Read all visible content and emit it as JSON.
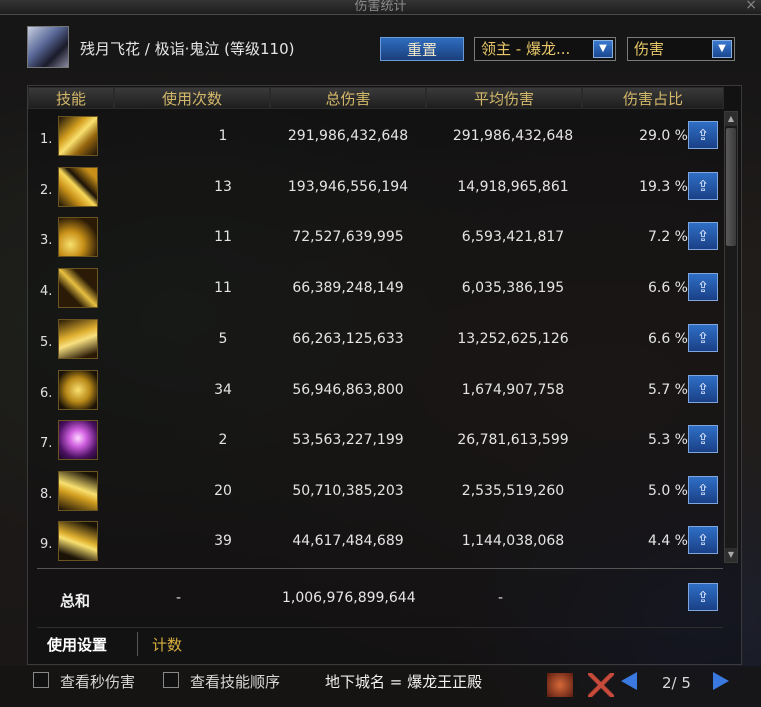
{
  "window": {
    "title": "伤害统计"
  },
  "character": {
    "name": "残月飞花 / 极诣·鬼泣 (等级110)"
  },
  "controls": {
    "reset_label": "重置",
    "target_select": "领主 - 爆龙...",
    "metric_select": "伤害"
  },
  "columns": [
    "技能",
    "使用次数",
    "总伤害",
    "平均伤害",
    "伤害占比"
  ],
  "rows": [
    {
      "rank": "1.",
      "count": "1",
      "total": "291,986,432,648",
      "avg": "291,986,432,648",
      "pct": "29.0 %",
      "icon": "skill-icon-gold-slash"
    },
    {
      "rank": "2.",
      "count": "13",
      "total": "193,946,556,194",
      "avg": "14,918,965,861",
      "pct": "19.3 %",
      "icon": "skill-icon-gold-blade"
    },
    {
      "rank": "3.",
      "count": "11",
      "total": "72,527,639,995",
      "avg": "6,593,421,817",
      "pct": "7.2 %",
      "icon": "skill-icon-gold-wave"
    },
    {
      "rank": "4.",
      "count": "11",
      "total": "66,389,248,149",
      "avg": "6,035,386,195",
      "pct": "6.6 %",
      "icon": "skill-icon-gold-cross"
    },
    {
      "rank": "5.",
      "count": "5",
      "total": "66,263,125,633",
      "avg": "13,252,625,126",
      "pct": "6.6 %",
      "icon": "skill-icon-gold-strike"
    },
    {
      "rank": "6.",
      "count": "34",
      "total": "56,946,863,800",
      "avg": "1,674,907,758",
      "pct": "5.7 %",
      "icon": "skill-icon-gold-swirl"
    },
    {
      "rank": "7.",
      "count": "2",
      "total": "53,563,227,199",
      "avg": "26,781,613,599",
      "pct": "5.3 %",
      "icon": "skill-icon-purple-burst"
    },
    {
      "rank": "8.",
      "count": "20",
      "total": "50,710,385,203",
      "avg": "2,535,519,260",
      "pct": "5.0 %",
      "icon": "skill-icon-gold-flame"
    },
    {
      "rank": "9.",
      "count": "39",
      "total": "44,617,484,689",
      "avg": "1,144,038,068",
      "pct": "4.4 %",
      "icon": "skill-icon-gold-arc"
    }
  ],
  "totals": {
    "label": "总和",
    "count": "-",
    "total": "1,006,976,899,644",
    "avg": "-"
  },
  "tabs": {
    "active": "使用设置",
    "inactive": "计数"
  },
  "footer": {
    "checkbox1_label": "查看秒伤害",
    "checkbox2_label": "查看技能顺序",
    "dungeon": "地下城名 = 爆龙王正殿",
    "page": "2/ 5"
  },
  "colors": {
    "accent_gold": "#d4b86a",
    "button_blue": "#2f6dc0"
  }
}
